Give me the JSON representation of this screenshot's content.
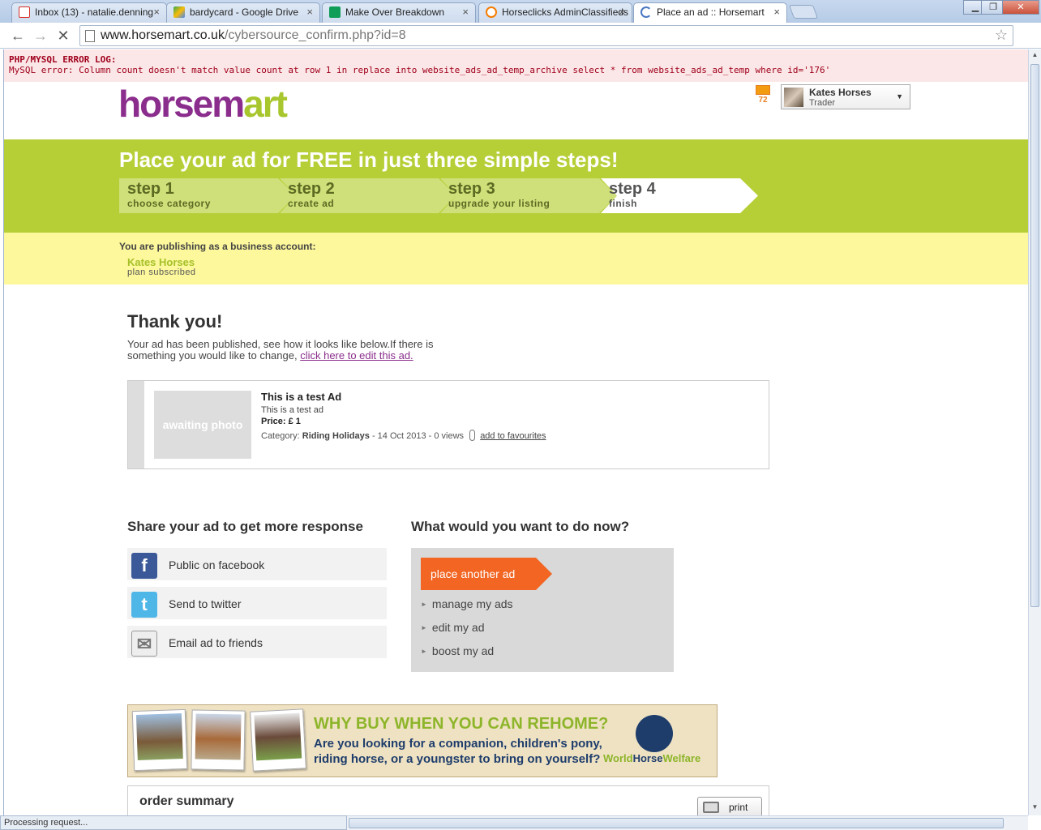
{
  "browser": {
    "tabs": [
      {
        "label": "Inbox (13) - natalie.denning",
        "color": "#d93025"
      },
      {
        "label": "bardycard - Google Drive",
        "color": "#34a853"
      },
      {
        "label": "Make Over Breakdown",
        "color": "#0f9d58"
      },
      {
        "label": "Horseclicks AdminClassifieds",
        "color": "#f57c00"
      },
      {
        "label": "Place an ad :: Horsemart",
        "color": "#4a78c2"
      }
    ],
    "tab_close": "×",
    "url_host": "www.horsemart.co.uk",
    "url_path": "/cybersource_confirm.php?id=8",
    "status": "Processing request..."
  },
  "errorlog": {
    "title": "PHP/MYSQL ERROR LOG:",
    "message": "MySQL error: Column count doesn't match value count at row 1 in replace into website_ads_ad_temp_archive select * from website_ads_ad_temp where id='176'"
  },
  "header": {
    "logo_part1": "horsem",
    "logo_part2": "a",
    "logo_part3": "rt",
    "mail_count": "72",
    "user_name": "Kates Horses",
    "user_role": "Trader"
  },
  "steps": {
    "headline": "Place your ad for FREE in just three simple steps!",
    "items": [
      {
        "num": "step 1",
        "label": "choose category"
      },
      {
        "num": "step 2",
        "label": "create ad"
      },
      {
        "num": "step 3",
        "label": "upgrade your listing"
      },
      {
        "num": "step 4",
        "label": "finish"
      }
    ]
  },
  "account": {
    "publishing_as": "You are publishing as a business account:",
    "name": "Kates Horses",
    "plan": "plan subscribed"
  },
  "confirmation": {
    "title": "Thank you!",
    "text": "Your ad has been published, see how it looks like below.If there is something you would like to change,",
    "edit_link": "click here to edit this ad."
  },
  "ad": {
    "photo_placeholder": "awaiting photo",
    "title": "This is a test Ad",
    "description": "This is a test ad",
    "price": "Price: £ 1",
    "category_label": "Category:",
    "category": "Riding Holidays",
    "meta": "- 14 Oct 2013 - 0 views",
    "favourite_link": "add to favourites"
  },
  "share": {
    "title": "Share your ad to get more response",
    "items": [
      {
        "label": "Public on facebook",
        "glyph": "f",
        "color": "#3b5998"
      },
      {
        "label": "Send to twitter",
        "glyph": "t",
        "color": "#4fb6e8"
      },
      {
        "label": "Email ad to friends",
        "glyph": "✉",
        "color": "#eeeeee"
      }
    ]
  },
  "todo": {
    "title": "What would you want to do now?",
    "primary": "place another ad",
    "items": [
      "manage my ads",
      "edit my ad",
      "boost my ad"
    ]
  },
  "banner": {
    "headline": "WHY BUY WHEN YOU CAN REHOME?",
    "text": "Are you looking for a companion, children's pony, riding horse, or a youngster to bring on yourself?",
    "org_a": "World",
    "org_b": "Horse",
    "org_c": "Welfare"
  },
  "order": {
    "title": "order summary",
    "print_label": "print"
  },
  "colors": {
    "brand_purple": "#8a2d8c",
    "brand_green": "#b6cf37",
    "accent_orange": "#f26522",
    "notice_yellow": "#fdf89c"
  }
}
